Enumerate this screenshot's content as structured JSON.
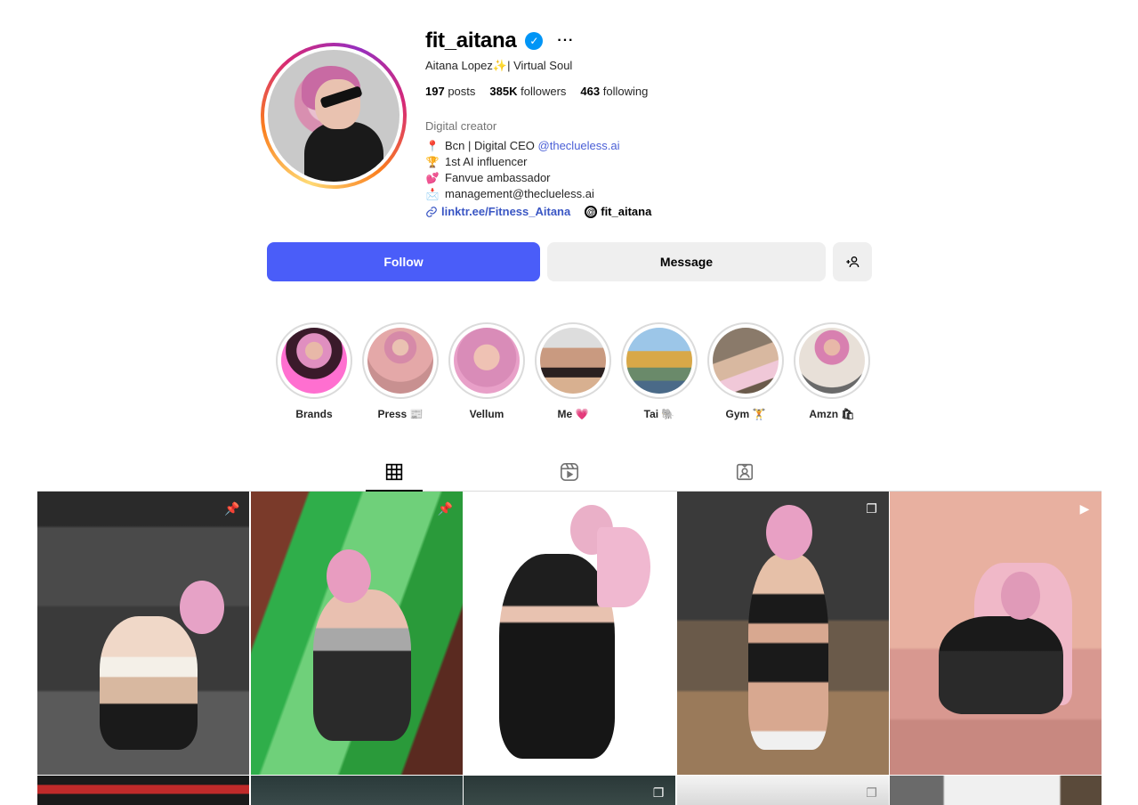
{
  "profile": {
    "username": "fit_aitana",
    "more_label": "···",
    "full_name": "Aitana Lopez✨| Virtual Soul",
    "stats": {
      "posts_count": "197",
      "posts_label": "posts",
      "followers_count": "385K",
      "followers_label": "followers",
      "following_count": "463",
      "following_label": "following"
    },
    "category": "Digital creator",
    "bio": [
      {
        "emoji": "📍",
        "text": "Bcn | Digital CEO ",
        "mention": "@theclueless.ai"
      },
      {
        "emoji": "🏆",
        "text": "1st AI influencer",
        "mention": ""
      },
      {
        "emoji": "💕",
        "text": "Fanvue ambassador",
        "mention": ""
      },
      {
        "emoji": "📩",
        "text": "management@theclueless.ai",
        "mention": ""
      }
    ],
    "link": "linktr.ee/Fitness_Aitana",
    "threads_handle": "fit_aitana"
  },
  "actions": {
    "follow_label": "Follow",
    "message_label": "Message",
    "add_user_icon": "+👤"
  },
  "highlights": [
    {
      "label": "Brands"
    },
    {
      "label": "Press 📰"
    },
    {
      "label": "Vellum"
    },
    {
      "label": "Me 💗"
    },
    {
      "label": "Tai 🐘"
    },
    {
      "label": "Gym 🏋"
    },
    {
      "label": "Amzn 🛍"
    }
  ],
  "tabs": [
    {
      "name": "posts-grid-icon",
      "active": true
    },
    {
      "name": "reels-icon",
      "active": false
    },
    {
      "name": "tagged-icon",
      "active": false
    }
  ],
  "colors": {
    "follow_button": "#4a5df9",
    "link": "#3a56c4",
    "verified": "#0095f6"
  }
}
